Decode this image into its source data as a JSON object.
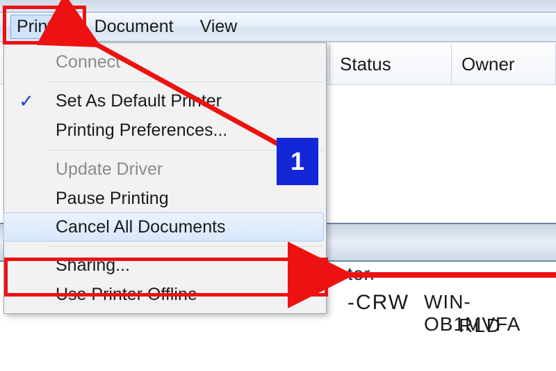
{
  "menu_bar": {
    "items": [
      "Printer",
      "Document",
      "View"
    ]
  },
  "columns": {
    "status": "Status",
    "owner": "Owner"
  },
  "dropdown": {
    "connect": "Connect",
    "set_default": "Set As Default Printer",
    "printing_prefs": "Printing Preferences...",
    "update_driver": "Update Driver",
    "pause_printing": "Pause Printing",
    "cancel_all": "Cancel All Documents",
    "sharing": "Sharing...",
    "use_offline": "Use Printer Offline"
  },
  "bg": {
    "ter": "ter.",
    "crw": "-CRW",
    "winob": "WIN-OB1MVFA",
    "rld": "RLD"
  },
  "callout": {
    "n1": "1"
  },
  "colors": {
    "red": "#ee1111",
    "blue": "#1427d8"
  }
}
